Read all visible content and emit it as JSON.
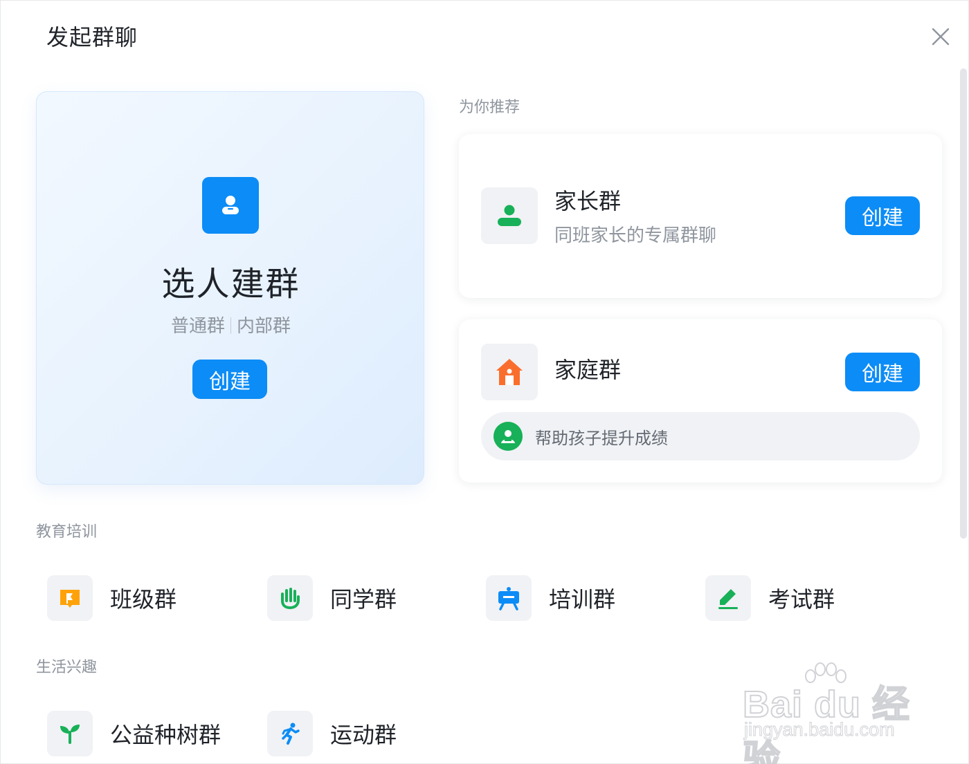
{
  "dialog": {
    "title": "发起群聊"
  },
  "pick": {
    "title": "选人建群",
    "sub_normal": "普通群",
    "sub_internal": "内部群",
    "create_label": "创建"
  },
  "recommend": {
    "label": "为你推荐",
    "parents": {
      "name": "家长群",
      "desc": "同班家长的专属群聊",
      "create_label": "创建"
    },
    "family": {
      "name": "家庭群",
      "create_label": "创建",
      "tip": "帮助孩子提升成绩"
    }
  },
  "education": {
    "label": "教育培训",
    "items": [
      {
        "label": "班级群",
        "icon": "book-flag-icon"
      },
      {
        "label": "同学群",
        "icon": "hand-icon"
      },
      {
        "label": "培训群",
        "icon": "presentation-icon"
      },
      {
        "label": "考试群",
        "icon": "pencil-icon"
      }
    ]
  },
  "life": {
    "label": "生活兴趣",
    "items": [
      {
        "label": "公益种树群",
        "icon": "sprout-icon"
      },
      {
        "label": "运动群",
        "icon": "runner-icon"
      }
    ]
  },
  "watermark": {
    "main": "Bai du 经验",
    "sub": "jingyan.baidu.com"
  },
  "colors": {
    "primary": "#0c8cf6",
    "green": "#18b058",
    "orange": "#fa6e2d",
    "yellow": "#ffa20a"
  }
}
